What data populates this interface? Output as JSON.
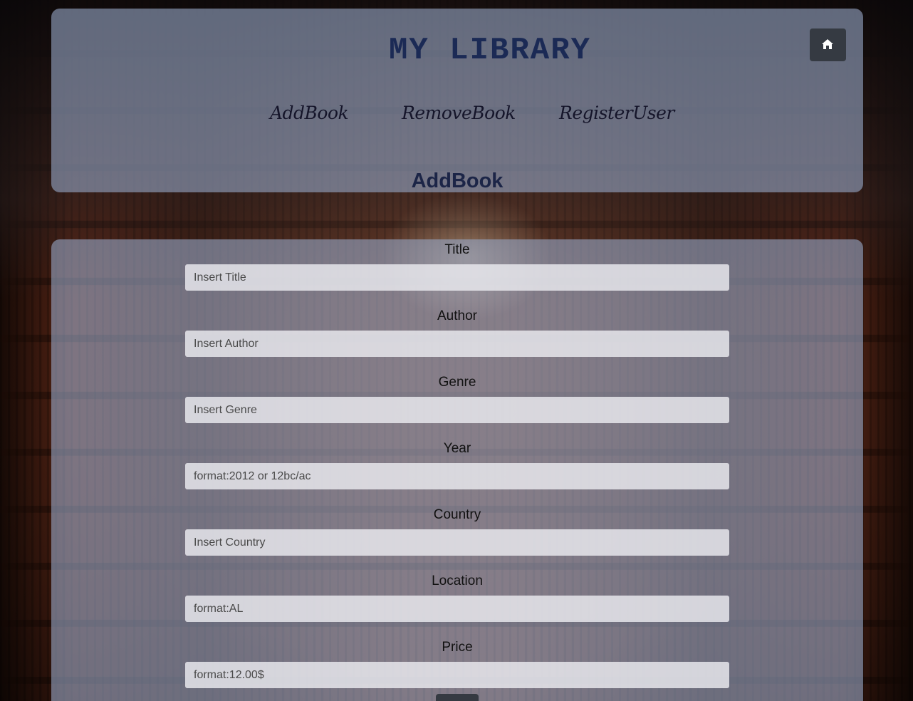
{
  "header": {
    "title": "MY LIBRARY",
    "home_icon": "home-icon",
    "nav": [
      {
        "label": "AddBook"
      },
      {
        "label": "RemoveBook"
      },
      {
        "label": "RegisterUser"
      }
    ],
    "section_title_light": "Add",
    "section_title_bold": "Book"
  },
  "form": {
    "fields": [
      {
        "label": "Title",
        "placeholder": "Insert Title"
      },
      {
        "label": "Author",
        "placeholder": "Insert Author"
      },
      {
        "label": "Genre",
        "placeholder": "Insert Genre"
      },
      {
        "label": "Year",
        "placeholder": "format:2012 or 12bc/ac"
      },
      {
        "label": "Country",
        "placeholder": "Insert Country"
      },
      {
        "label": "Location",
        "placeholder": "format:AL"
      },
      {
        "label": "Price",
        "placeholder": "format:12.00$"
      }
    ],
    "submit_label": ""
  },
  "colors": {
    "panel": "#94a5c3",
    "title": "#1b2a55",
    "button_dark": "#353a42"
  }
}
